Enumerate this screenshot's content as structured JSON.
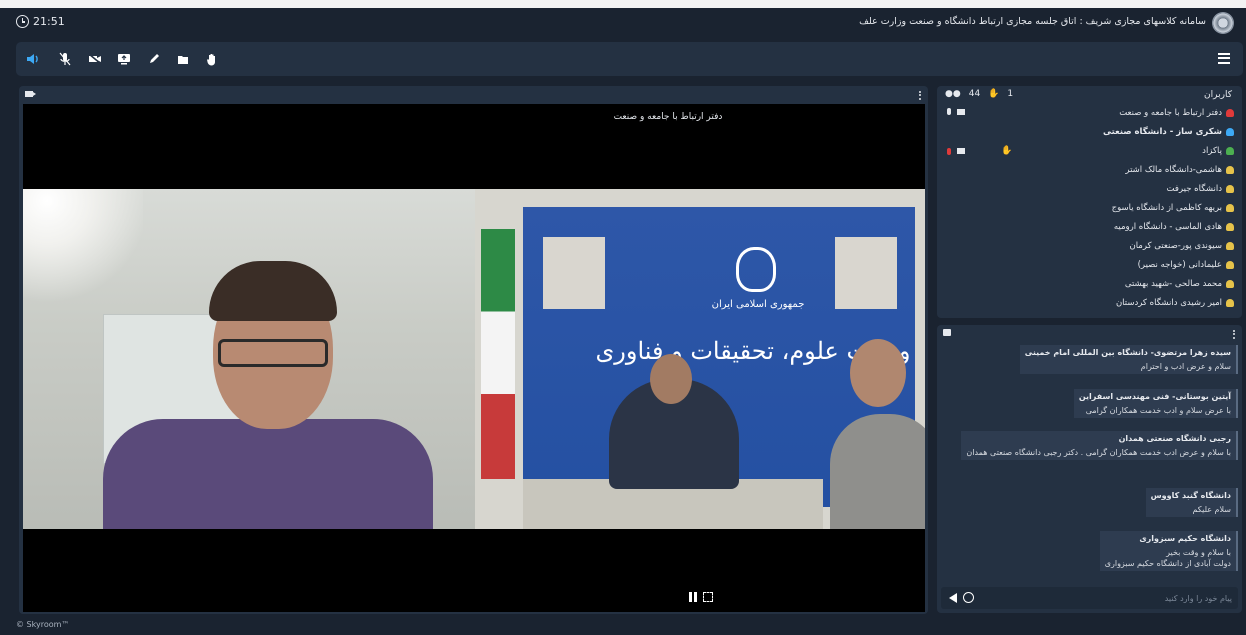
{
  "window": {
    "clock": "21:51",
    "title": "سامانه کلاسهای مجازی شریف : اتاق جلسه مجازی ارتباط دانشگاه و صنعت وزارت علف"
  },
  "toolbar": {
    "buttons": [
      {
        "name": "speaker-button",
        "icon": "speaker-icon"
      },
      {
        "name": "mic-button",
        "icon": "mic-off-icon"
      },
      {
        "name": "camera-button",
        "icon": "camera-off-icon"
      },
      {
        "name": "screen-share-button",
        "icon": "screen-share-icon"
      },
      {
        "name": "pen-button",
        "icon": "pen-icon"
      },
      {
        "name": "file-button",
        "icon": "file-icon"
      },
      {
        "name": "hand-button",
        "icon": "hand-icon"
      }
    ]
  },
  "video": {
    "speaker_label": "دفتر ارتباط با جامعه و صنعت",
    "banner_sub": "جمهوری اسلامی ایران",
    "banner_text": "وزارت علوم، تحقیقات و فناوری"
  },
  "users": {
    "title": "کاربران",
    "total_count": "44",
    "raised_hands": "1",
    "list": [
      {
        "name": "دفتر ارتباط با جامعه و صنعت",
        "color": "#e03a3a",
        "bold": false,
        "mic": true,
        "cam": true,
        "hand": false
      },
      {
        "name": "شکری ساز - دانشگاه صنعتی",
        "color": "#3da9f5",
        "bold": true,
        "mic": false,
        "cam": false,
        "hand": false
      },
      {
        "name": "پاکزاد",
        "color": "#4caf50",
        "bold": false,
        "mic": true,
        "cam": true,
        "hand": true
      },
      {
        "name": "هاشمی-دانشگاه مالک اشتر",
        "color": "#e6c34a",
        "bold": false
      },
      {
        "name": "دانشگاه جیرفت",
        "color": "#e6c34a",
        "bold": false
      },
      {
        "name": "بریهه کاظمی از دانشگاه یاسوج",
        "color": "#e6c34a",
        "bold": false
      },
      {
        "name": "هادی الماسی - دانشگاه ارومیه",
        "color": "#e6c34a",
        "bold": false
      },
      {
        "name": "سیوندی پور-صنعتی کرمان",
        "color": "#e6c34a",
        "bold": false
      },
      {
        "name": "علیمادانی (خواجه نصیر)",
        "color": "#e6c34a",
        "bold": false
      },
      {
        "name": "محمد صالحی -شهید بهشتی",
        "color": "#e6c34a",
        "bold": false
      },
      {
        "name": "امیر رشیدی دانشگاه کردستان",
        "color": "#e6c34a",
        "bold": false
      }
    ]
  },
  "chat": {
    "messages": [
      {
        "sender": "سیده زهرا مرتضوی- دانشگاه بین المللی امام خمینی",
        "lines": [
          "سلام و عرض ادب و احترام"
        ]
      },
      {
        "sender": "آیتین بوستانی- فنی مهندسی اسفراین",
        "lines": [
          "با عرض سلام و ادب خدمت همکاران گرامی"
        ]
      },
      {
        "sender": "رجبی دانشگاه صنعتی همدان",
        "lines": [
          "با سلام و عرض ادب خدمت همکاران گرامی . دکتر رجبی دانشگاه صنعتی همدان"
        ]
      },
      {
        "sender": "دانشگاه گنبد کاووس",
        "lines": [
          "سلام علیکم"
        ]
      },
      {
        "sender": "دانشگاه حکیم سبزواری",
        "lines": [
          "با سلام و وقت بخیر",
          "دولت آبادی از دانشگاه حکیم سبزواری"
        ]
      }
    ],
    "input_placeholder": "پیام خود را وارد کنید"
  },
  "footer": {
    "copyright": "© Skyroom™"
  }
}
